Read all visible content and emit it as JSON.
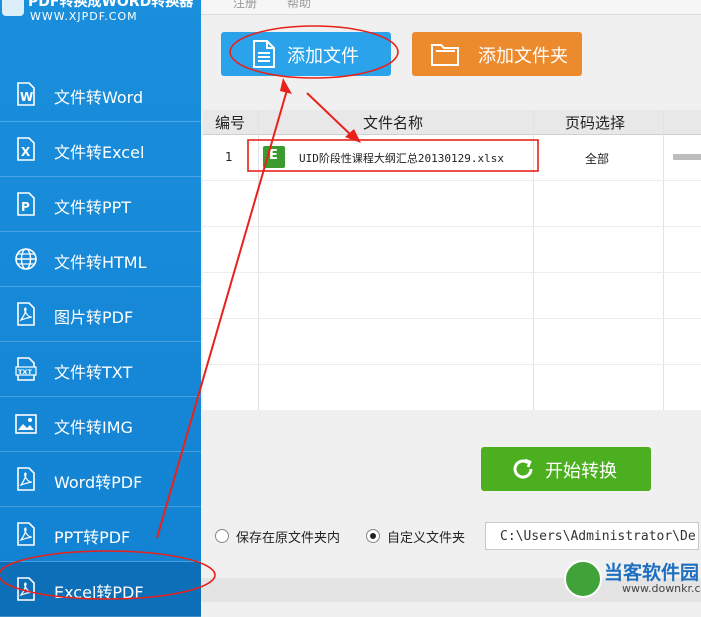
{
  "app": {
    "title": "PDF转换成WORD转换器",
    "url": "WWW.XJPDF.COM"
  },
  "topmenu": {
    "register": "注册",
    "help": "帮助"
  },
  "sidebar": {
    "items": [
      {
        "label": "文件转Word",
        "icon": "word-doc-icon"
      },
      {
        "label": "文件转Excel",
        "icon": "excel-doc-icon"
      },
      {
        "label": "文件转PPT",
        "icon": "ppt-doc-icon"
      },
      {
        "label": "文件转HTML",
        "icon": "globe-icon"
      },
      {
        "label": "图片转PDF",
        "icon": "pdf-doc-icon"
      },
      {
        "label": "文件转TXT",
        "icon": "txt-doc-icon"
      },
      {
        "label": "文件转IMG",
        "icon": "image-icon"
      },
      {
        "label": "Word转PDF",
        "icon": "pdf-doc-icon"
      },
      {
        "label": "PPT转PDF",
        "icon": "pdf-doc-icon"
      },
      {
        "label": "Excel转PDF",
        "icon": "pdf-doc-icon"
      }
    ]
  },
  "toolbar": {
    "add_file": "添加文件",
    "add_folder": "添加文件夹"
  },
  "table": {
    "headers": [
      "编号",
      "文件名称",
      "页码选择"
    ],
    "rows": [
      {
        "index": "1",
        "filename": "UID阶段性课程大纲汇总20130129.xlsx",
        "pages": "全部"
      }
    ]
  },
  "actions": {
    "start": "开始转换"
  },
  "save": {
    "option_original": "保存在原文件夹内",
    "option_custom": "自定义文件夹",
    "selected": "custom",
    "path": "C:\\Users\\Administrator\\De"
  },
  "watermark": {
    "name": "当客软件园",
    "url": "www.downkr.com"
  },
  "colors": {
    "sidebar": "#1a8fdc",
    "add_file": "#2aa3eb",
    "add_folder": "#ec8a2e",
    "start": "#4caf1f",
    "annotation": "#e8221b"
  }
}
